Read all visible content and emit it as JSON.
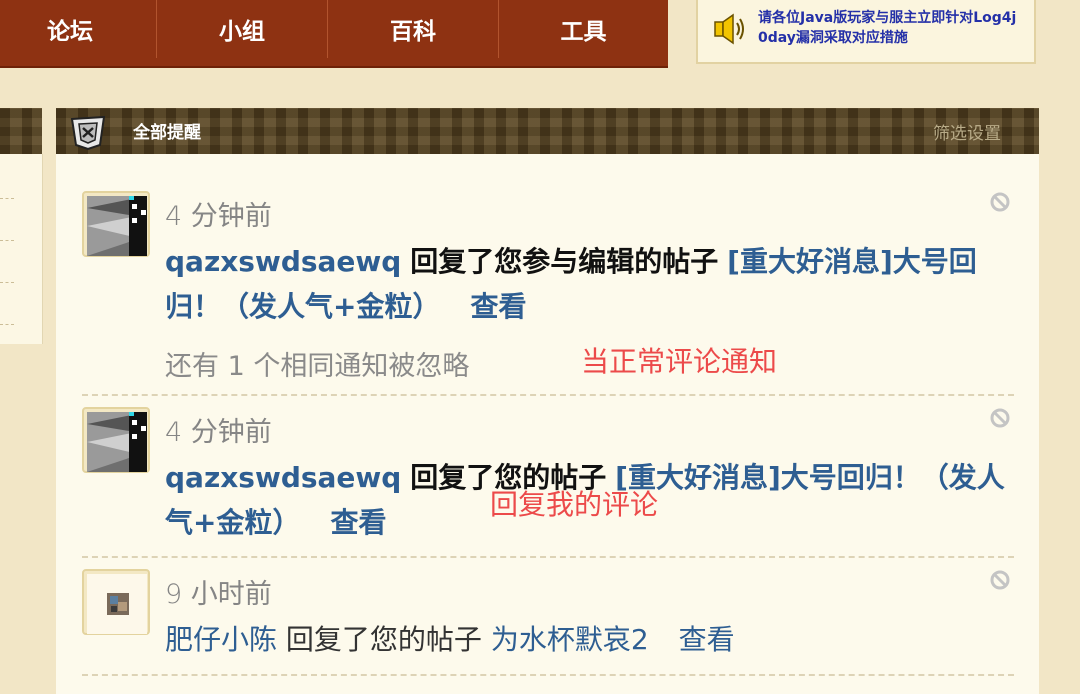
{
  "nav": {
    "items": [
      "论坛",
      "小组",
      "百科",
      "工具"
    ]
  },
  "notice": {
    "icon": "speaker-icon",
    "text": "请各位Java版玩家与服主立即针对Log4j 0day漏洞采取对应措施"
  },
  "panel": {
    "title": "全部提醒",
    "filter_label": "筛选设置"
  },
  "notifications": [
    {
      "time": "4 分钟前",
      "user": "qazxswdsaewq",
      "action": "回复了您参与编辑的帖子",
      "thread": "[重大好消息]大号回归！（发人气+金粒）",
      "view_label": "查看",
      "extra": "还有 1 个相同通知被忽略",
      "annotation": "当正常评论通知"
    },
    {
      "time": "4 分钟前",
      "user": "qazxswdsaewq",
      "action": "回复了您的帖子",
      "thread": "[重大好消息]大号回归！（发人气+金粒）",
      "view_label": "查看",
      "annotation": "回复我的评论"
    },
    {
      "time": "9 小时前",
      "user": "肥仔小陈",
      "action": "回复了您的帖子",
      "thread": "为水杯默哀2",
      "view_label": "查看"
    }
  ],
  "colors": {
    "nav_bg": "#8e3212",
    "link": "#2e5e92",
    "annotation": "#ec4a4a",
    "notice_text": "#2430a8"
  }
}
